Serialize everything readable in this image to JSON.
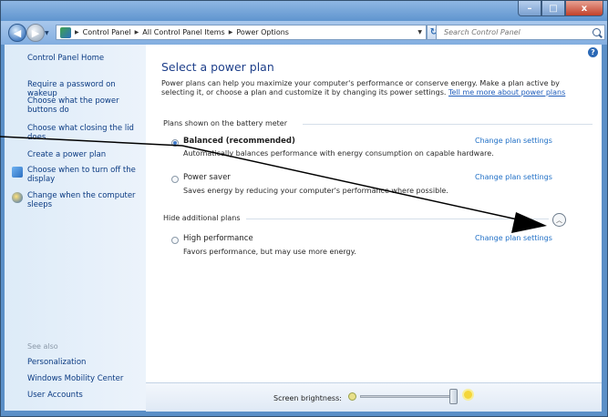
{
  "window": {
    "controls": {
      "minimize": "–",
      "maximize": "□",
      "close": "x"
    }
  },
  "address": {
    "crumbs": [
      "Control Panel",
      "All Control Panel Items",
      "Power Options"
    ],
    "search_placeholder": "Search Control Panel"
  },
  "sidebar": {
    "home": "Control Panel Home",
    "links": [
      "Require a password on wakeup",
      "Choose what the power buttons do",
      "Choose what closing the lid does",
      "Create a power plan",
      "Choose when to turn off the display",
      "Change when the computer sleeps"
    ],
    "see_also_label": "See also",
    "see_also": [
      "Personalization",
      "Windows Mobility Center",
      "User Accounts"
    ]
  },
  "main": {
    "title": "Select a power plan",
    "intro": "Power plans can help you maximize your computer's performance or conserve energy. Make a plan active by selecting it, or choose a plan and customize it by changing its power settings.",
    "intro_link": "Tell me more about power plans",
    "battery_group": "Plans shown on the battery meter",
    "additional_group": "Hide additional plans",
    "change_link": "Change plan settings",
    "plans": [
      {
        "name": "Balanced (recommended)",
        "desc": "Automatically balances performance with energy consumption on capable hardware.",
        "selected": true
      },
      {
        "name": "Power saver",
        "desc": "Saves energy by reducing your computer's performance where possible.",
        "selected": false
      },
      {
        "name": "High performance",
        "desc": "Favors performance, but may use more energy.",
        "selected": false
      }
    ]
  },
  "status": {
    "brightness_label": "Screen brightness:",
    "brightness_level": 0.95
  }
}
